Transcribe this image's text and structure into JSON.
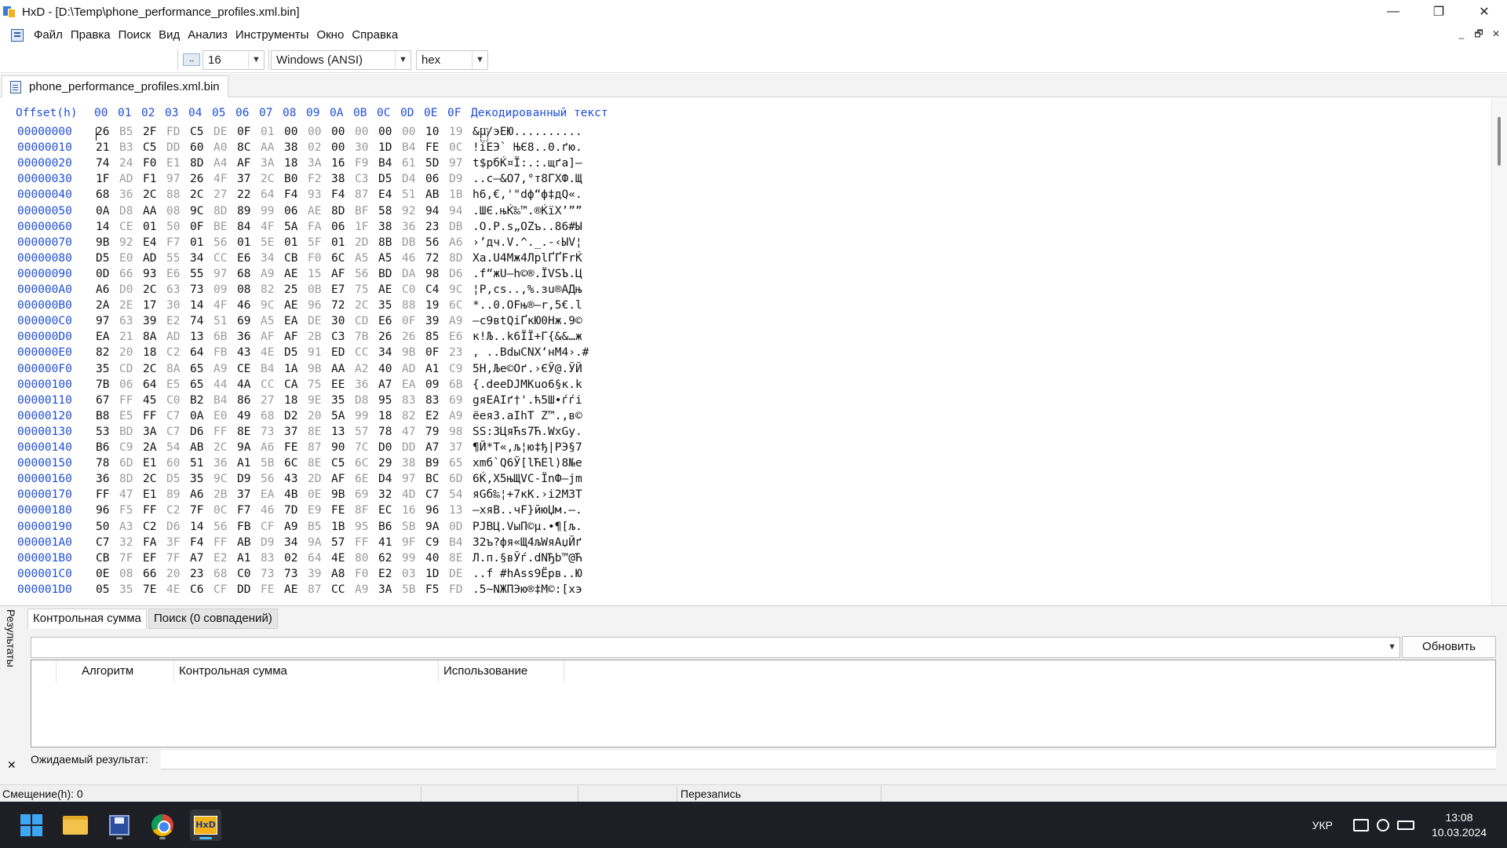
{
  "window": {
    "title": "HxD - [D:\\Temp\\phone_performance_profiles.xml.bin]",
    "controls": [
      "—",
      "❐",
      "✕"
    ]
  },
  "menu": {
    "items": [
      "Файл",
      "Правка",
      "Поиск",
      "Вид",
      "Анализ",
      "Инструменты",
      "Окно",
      "Справка"
    ],
    "mdi_controls": [
      "_",
      "🗗",
      "✕"
    ]
  },
  "toolbar": {
    "columns_value": "16",
    "charset_value": "Windows (ANSI)",
    "offset_base_value": "hex"
  },
  "document_tab": {
    "label": "phone_performance_profiles.xml.bin"
  },
  "hex_view": {
    "header_offset": "Offset(h)",
    "header_columns": [
      "00",
      "01",
      "02",
      "03",
      "04",
      "05",
      "06",
      "07",
      "08",
      "09",
      "0A",
      "0B",
      "0C",
      "0D",
      "0E",
      "0F"
    ],
    "header_decoded": "Декодированный текст",
    "rows": [
      {
        "offset": "00000000",
        "bytes": [
          "26",
          "B5",
          "2F",
          "FD",
          "C5",
          "DE",
          "0F",
          "01",
          "00",
          "00",
          "00",
          "00",
          "00",
          "00",
          "10",
          "19"
        ],
        "text": "&µ/эЕЮ.........."
      },
      {
        "offset": "00000010",
        "bytes": [
          "21",
          "B3",
          "C5",
          "DD",
          "60",
          "A0",
          "8C",
          "AA",
          "38",
          "02",
          "00",
          "30",
          "1D",
          "B4",
          "FE",
          "0C"
        ],
        "text": "!іЕЭ` ЊЄ8..0.ґю."
      },
      {
        "offset": "00000020",
        "bytes": [
          "74",
          "24",
          "F0",
          "E1",
          "8D",
          "A4",
          "AF",
          "3A",
          "18",
          "3A",
          "16",
          "F9",
          "B4",
          "61",
          "5D",
          "97"
        ],
        "text": "t$рбЌ¤Ї:.:.щґa]—"
      },
      {
        "offset": "00000030",
        "bytes": [
          "1F",
          "AD",
          "F1",
          "97",
          "26",
          "4F",
          "37",
          "2C",
          "B0",
          "F2",
          "38",
          "C3",
          "D5",
          "D4",
          "06",
          "D9"
        ],
        "text": "..с—&O7,°т8ГХФ.Щ"
      },
      {
        "offset": "00000040",
        "bytes": [
          "68",
          "36",
          "2C",
          "88",
          "2C",
          "27",
          "22",
          "64",
          "F4",
          "93",
          "F4",
          "87",
          "E4",
          "51",
          "AB",
          "1B"
        ],
        "text": "h6,€,'\"dф“ф‡дQ«."
      },
      {
        "offset": "00000050",
        "bytes": [
          "0A",
          "D8",
          "AA",
          "08",
          "9C",
          "8D",
          "89",
          "99",
          "06",
          "AE",
          "8D",
          "BF",
          "58",
          "92",
          "94",
          "94"
        ],
        "text": ".ШЄ.њЌ‰™.®ЌїX’””"
      },
      {
        "offset": "00000060",
        "bytes": [
          "14",
          "CE",
          "01",
          "50",
          "0F",
          "BE",
          "84",
          "4F",
          "5A",
          "FA",
          "06",
          "1F",
          "38",
          "36",
          "23",
          "DB"
        ],
        "text": ".О.P.s„OZъ..86#Ы"
      },
      {
        "offset": "00000070",
        "bytes": [
          "9B",
          "92",
          "E4",
          "F7",
          "01",
          "56",
          "01",
          "5E",
          "01",
          "5F",
          "01",
          "2D",
          "8B",
          "DB",
          "56",
          "A6"
        ],
        "text": "›’дч.V.^._.-‹ЫV¦"
      },
      {
        "offset": "00000080",
        "bytes": [
          "D5",
          "E0",
          "AD",
          "55",
          "34",
          "CC",
          "E6",
          "34",
          "CB",
          "F0",
          "6C",
          "A5",
          "A5",
          "46",
          "72",
          "8D"
        ],
        "text": "Ха.U4Мж4ЛрlҐҐFrЌ"
      },
      {
        "offset": "00000090",
        "bytes": [
          "0D",
          "66",
          "93",
          "E6",
          "55",
          "97",
          "68",
          "A9",
          "AE",
          "15",
          "AF",
          "56",
          "BD",
          "DA",
          "98",
          "D6"
        ],
        "text": ".f“жU—h©®.ЇVЅЪ.Ц"
      },
      {
        "offset": "000000A0",
        "bytes": [
          "A6",
          "D0",
          "2C",
          "63",
          "73",
          "09",
          "08",
          "82",
          "25",
          "0B",
          "E7",
          "75",
          "AE",
          "C0",
          "C4",
          "9C"
        ],
        "text": "¦Р,cs..‚%.зu®АДњ"
      },
      {
        "offset": "000000B0",
        "bytes": [
          "2A",
          "2E",
          "17",
          "30",
          "14",
          "4F",
          "46",
          "9C",
          "AE",
          "96",
          "72",
          "2C",
          "35",
          "88",
          "19",
          "6C"
        ],
        "text": "*..0.OFњ®–r,5€.l"
      },
      {
        "offset": "000000C0",
        "bytes": [
          "97",
          "63",
          "39",
          "E2",
          "74",
          "51",
          "69",
          "A5",
          "EA",
          "DE",
          "30",
          "CD",
          "E6",
          "0F",
          "39",
          "A9"
        ],
        "text": "—c9вtQiҐкЮ0Нж.9©"
      },
      {
        "offset": "000000D0",
        "bytes": [
          "EA",
          "21",
          "8A",
          "AD",
          "13",
          "6B",
          "36",
          "AF",
          "AF",
          "2B",
          "C3",
          "7B",
          "26",
          "26",
          "85",
          "E6"
        ],
        "text": "к!Љ..k6ЇЇ+Г{&&…ж"
      },
      {
        "offset": "000000E0",
        "bytes": [
          "82",
          "20",
          "18",
          "C2",
          "64",
          "FB",
          "43",
          "4E",
          "D5",
          "91",
          "ED",
          "CC",
          "34",
          "9B",
          "0F",
          "23"
        ],
        "text": "‚ ..ВdыCNХ‘нМ4›.#"
      },
      {
        "offset": "000000F0",
        "bytes": [
          "35",
          "CD",
          "2C",
          "8A",
          "65",
          "A9",
          "CE",
          "B4",
          "1A",
          "9B",
          "AA",
          "A2",
          "40",
          "AD",
          "A1",
          "C9"
        ],
        "text": "5Н,Љe©Оґ.›ЄЎ@.ЎЙ"
      },
      {
        "offset": "00000100",
        "bytes": [
          "7B",
          "06",
          "64",
          "E5",
          "65",
          "44",
          "4A",
          "CC",
          "CA",
          "75",
          "EE",
          "36",
          "A7",
          "EA",
          "09",
          "6B"
        ],
        "text": "{.deeDJМКuо6§к.k"
      },
      {
        "offset": "00000110",
        "bytes": [
          "67",
          "FF",
          "45",
          "C0",
          "B2",
          "B4",
          "86",
          "27",
          "18",
          "9E",
          "35",
          "D8",
          "95",
          "83",
          "83",
          "69"
        ],
        "text": "gяEАІґ†'.ћ5Ш•ѓѓi"
      },
      {
        "offset": "00000120",
        "bytes": [
          "B8",
          "E5",
          "FF",
          "C7",
          "0A",
          "E0",
          "49",
          "68",
          "D2",
          "20",
          "5A",
          "99",
          "18",
          "82",
          "E2",
          "A9"
        ],
        "text": "ёеяЗ.аIhТ Z™.‚в©"
      },
      {
        "offset": "00000130",
        "bytes": [
          "53",
          "BD",
          "3A",
          "C7",
          "D6",
          "FF",
          "8E",
          "73",
          "37",
          "8E",
          "13",
          "57",
          "78",
          "47",
          "79",
          "98"
        ],
        "text": "SЅ:ЗЦяЋs7Ћ.WxGy."
      },
      {
        "offset": "00000140",
        "bytes": [
          "B6",
          "C9",
          "2A",
          "54",
          "AB",
          "2C",
          "9A",
          "A6",
          "FE",
          "87",
          "90",
          "7C",
          "D0",
          "DD",
          "A7",
          "37"
        ],
        "text": "¶Й*T«,љ¦ю‡ђ|РЭ§7"
      },
      {
        "offset": "00000150",
        "bytes": [
          "78",
          "6D",
          "E1",
          "60",
          "51",
          "36",
          "A1",
          "5B",
          "6C",
          "8E",
          "C5",
          "6C",
          "29",
          "38",
          "B9",
          "65"
        ],
        "text": "xmб`Q6Ў[lЋЕl)8№e"
      },
      {
        "offset": "00000160",
        "bytes": [
          "36",
          "8D",
          "2C",
          "D5",
          "35",
          "9C",
          "D9",
          "56",
          "43",
          "2D",
          "AF",
          "6E",
          "D4",
          "97",
          "BC",
          "6D"
        ],
        "text": "6Ќ,Х5њЩVC-ЇnФ—јm"
      },
      {
        "offset": "00000170",
        "bytes": [
          "FF",
          "47",
          "E1",
          "89",
          "A6",
          "2B",
          "37",
          "EA",
          "4B",
          "0E",
          "9B",
          "69",
          "32",
          "4D",
          "C7",
          "54"
        ],
        "text": "яGб‰¦+7кK.›i2MЗT"
      },
      {
        "offset": "00000180",
        "bytes": [
          "96",
          "F5",
          "FF",
          "C2",
          "7F",
          "0C",
          "F7",
          "46",
          "7D",
          "E9",
          "FE",
          "8F",
          "EC",
          "16",
          "96",
          "13"
        ],
        "text": "–хяВ..чF}йюЏм.–."
      },
      {
        "offset": "00000190",
        "bytes": [
          "50",
          "A3",
          "C2",
          "D6",
          "14",
          "56",
          "FB",
          "CF",
          "A9",
          "B5",
          "1B",
          "95",
          "B6",
          "5B",
          "9A",
          "0D"
        ],
        "text": "PЈВЦ.VыП©µ.•¶[љ."
      },
      {
        "offset": "000001A0",
        "bytes": [
          "C7",
          "32",
          "FA",
          "3F",
          "F4",
          "FF",
          "AB",
          "D9",
          "34",
          "9A",
          "57",
          "FF",
          "41",
          "9F",
          "C9",
          "B4"
        ],
        "text": "З2ъ?фя«Щ4љWяAџЙґ"
      },
      {
        "offset": "000001B0",
        "bytes": [
          "CB",
          "7F",
          "EF",
          "7F",
          "A7",
          "E2",
          "A1",
          "83",
          "02",
          "64",
          "4E",
          "80",
          "62",
          "99",
          "40",
          "8E"
        ],
        "text": "Л.п.§вЎѓ.dNЂb™@Ћ"
      },
      {
        "offset": "000001C0",
        "bytes": [
          "0E",
          "08",
          "66",
          "20",
          "23",
          "68",
          "C0",
          "73",
          "73",
          "39",
          "A8",
          "F0",
          "E2",
          "03",
          "1D",
          "DE"
        ],
        "text": "..f #hАss9Ёрв..Ю"
      },
      {
        "offset": "000001D0",
        "bytes": [
          "05",
          "35",
          "7E",
          "4E",
          "C6",
          "CF",
          "DD",
          "FE",
          "AE",
          "87",
          "CC",
          "A9",
          "3A",
          "5B",
          "F5",
          "FD"
        ],
        "text": ".5~NЖПЭю®‡М©:[хэ"
      }
    ]
  },
  "results_panel": {
    "side_label": "Результаты",
    "close_label": "✕",
    "tabs": [
      "Контрольная сумма",
      "Поиск (0 совпадений)"
    ],
    "refresh_button": "Обновить",
    "columns": [
      "Алгоритм",
      "Контрольная сумма",
      "Использование"
    ],
    "expected_label": "Ожидаемый результат:"
  },
  "status_bar": {
    "offset": "Смещение(h): 0",
    "mode": "Перезапись"
  },
  "taskbar": {
    "language": "УКР",
    "time": "13:08",
    "date": "10.03.2024"
  },
  "colors": {
    "hex_blue": "#1f4fd8",
    "light_byte": "#9a9a9a",
    "taskbar_bg": "#1d1f24"
  }
}
